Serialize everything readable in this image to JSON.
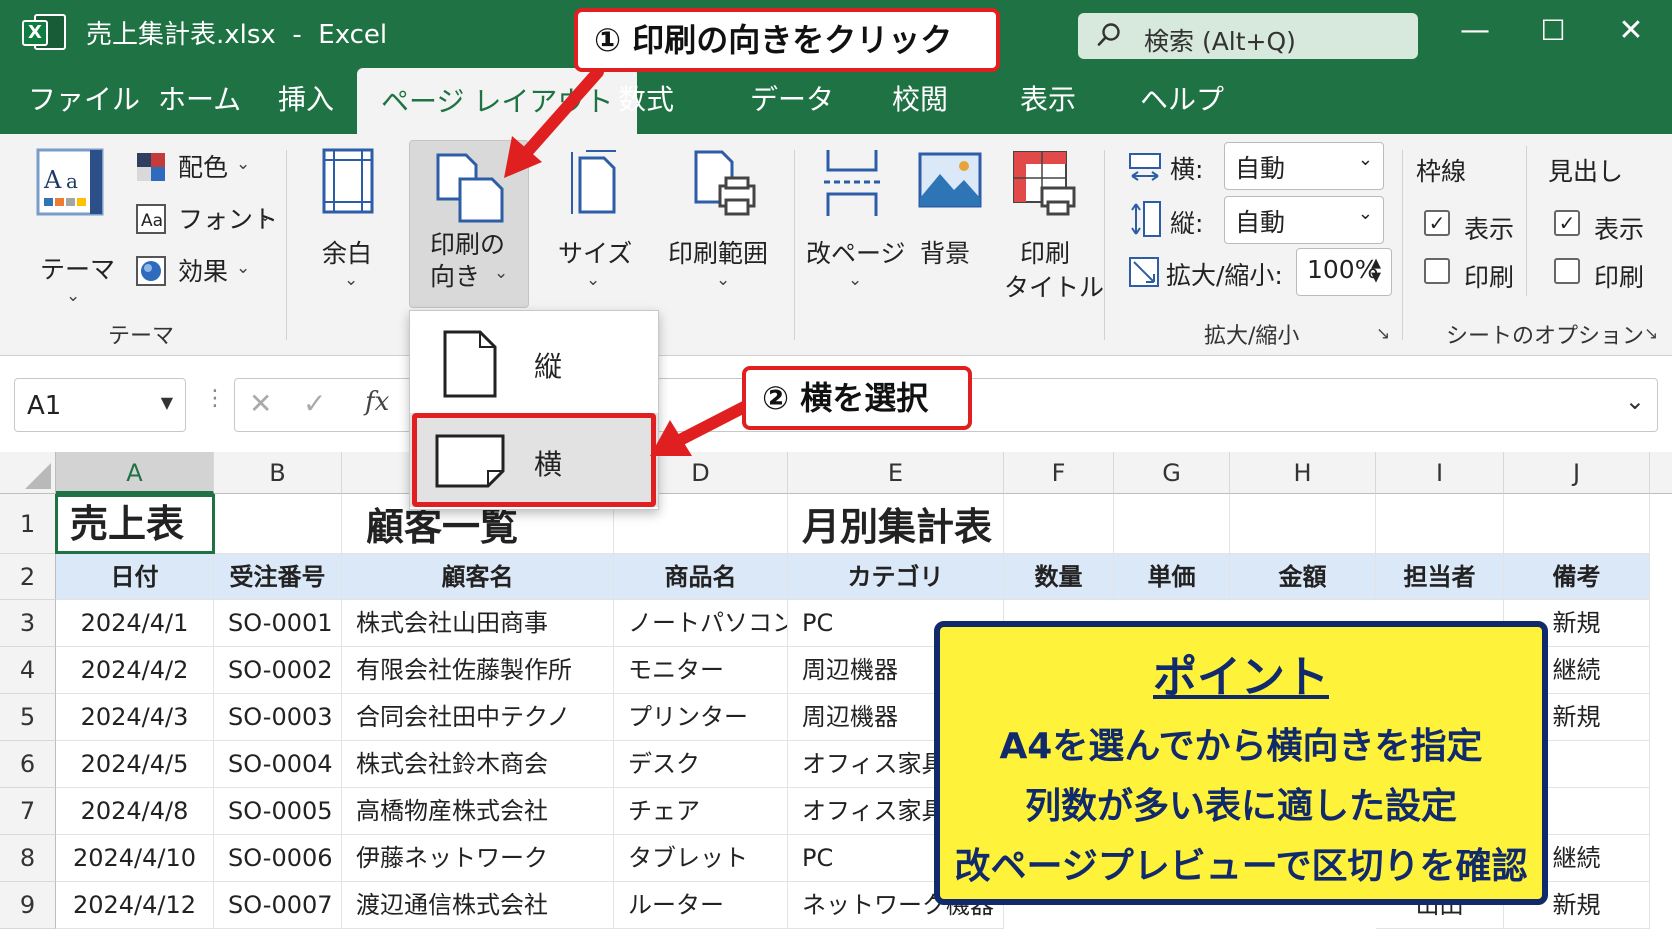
{
  "titlebar": {
    "filename": "売上集計表.xlsx",
    "separator": "-",
    "app": "Excel",
    "search_placeholder": "検索 (Alt+Q)",
    "minimize": "—",
    "maximize": "☐",
    "close": "✕"
  },
  "tabs": [
    {
      "label": "ファイル",
      "active": false
    },
    {
      "label": "ホーム",
      "active": false
    },
    {
      "label": "挿入",
      "active": false
    },
    {
      "label": "ページ レイアウト",
      "active": true
    },
    {
      "label": "数式",
      "active": false
    },
    {
      "label": "データ",
      "active": false
    },
    {
      "label": "校閲",
      "active": false
    },
    {
      "label": "表示",
      "active": false
    },
    {
      "label": "ヘルプ",
      "active": false
    }
  ],
  "ribbon": {
    "theme": {
      "theme_label": "テーマ",
      "colors": "配色",
      "fonts": "フォント",
      "effects": "効果",
      "group": "テーマ"
    },
    "page_setup": {
      "margins": "余白",
      "orientation_line1": "印刷の",
      "orientation_line2": "向き",
      "size": "サイズ",
      "print_area": "印刷範囲",
      "breaks": "改ページ",
      "background": "背景",
      "print_titles_line1": "印刷",
      "print_titles_line2": "タイトル"
    },
    "scale": {
      "width_label": "横:",
      "width_value": "自動",
      "height_label": "縦:",
      "height_value": "自動",
      "scale_label": "拡大/縮小:",
      "scale_value": "100%",
      "group": "拡大/縮小"
    },
    "sheet_options": {
      "gridlines": "枠線",
      "headings": "見出し",
      "view": "表示",
      "print": "印刷",
      "group": "シートのオプション",
      "gridlines_view_checked": true,
      "gridlines_print_checked": false,
      "headings_view_checked": true,
      "headings_print_checked": false
    }
  },
  "orientation_menu": {
    "portrait": "縦",
    "landscape": "横",
    "selected": "横"
  },
  "formula_bar": {
    "name_box": "A1",
    "fx": "fx",
    "cancel": "✕",
    "enter": "✓",
    "dots": "⋮",
    "expand": "⌄"
  },
  "columns": [
    "A",
    "B",
    "C",
    "D",
    "E",
    "F",
    "G",
    "H",
    "I",
    "J"
  ],
  "row_numbers": [
    "1",
    "2",
    "3",
    "4",
    "5",
    "6",
    "7",
    "8",
    "9"
  ],
  "sheet": {
    "row1": {
      "a": "売上表",
      "c": "顧客一覧",
      "e": "月別集計表"
    },
    "headers": [
      "日付",
      "受注番号",
      "顧客名",
      "商品名",
      "カテゴリ",
      "数量",
      "単価",
      "金額",
      "担当者",
      "備考"
    ],
    "rows": [
      {
        "date": "2024/4/1",
        "order": "SO-0001",
        "customer": "株式会社山田商事",
        "product": "ノートパソコン",
        "category": "PC",
        "staff": "",
        "note": "新規"
      },
      {
        "date": "2024/4/2",
        "order": "SO-0002",
        "customer": "有限会社佐藤製作所",
        "product": "モニター",
        "category": "周辺機器",
        "staff": "",
        "note": "継続"
      },
      {
        "date": "2024/4/3",
        "order": "SO-0003",
        "customer": "合同会社田中テクノ",
        "product": "プリンター",
        "category": "周辺機器",
        "staff": "",
        "note": "新規"
      },
      {
        "date": "2024/4/5",
        "order": "SO-0004",
        "customer": "株式会社鈴木商会",
        "product": "デスク",
        "category": "オフィス家具",
        "staff": "",
        "note": ""
      },
      {
        "date": "2024/4/8",
        "order": "SO-0005",
        "customer": "高橋物産株式会社",
        "product": "チェア",
        "category": "オフィス家具",
        "staff": "",
        "note": ""
      },
      {
        "date": "2024/4/10",
        "order": "SO-0006",
        "customer": "伊藤ネットワーク",
        "product": "タブレット",
        "category": "PC",
        "staff": "",
        "note": "継続"
      },
      {
        "date": "2024/4/12",
        "order": "SO-0007",
        "customer": "渡辺通信株式会社",
        "product": "ルーター",
        "category": "ネットワーク機器",
        "staff": "山田",
        "note": "新規"
      }
    ]
  },
  "callouts": {
    "step1": "① 印刷の向きをクリック",
    "step2": "② 横を選択",
    "point_title": "ポイント",
    "point_lines": [
      "A4を選んでから横向きを指定",
      "列数が多い表に適した設定",
      "改ページプレビューで区切りを確認"
    ]
  },
  "colors": {
    "excel_green": "#1f7244",
    "callout_red": "#e02020",
    "point_yellow": "#fff23b",
    "point_navy": "#102a6b",
    "header_blue": "#dbe8f8"
  }
}
